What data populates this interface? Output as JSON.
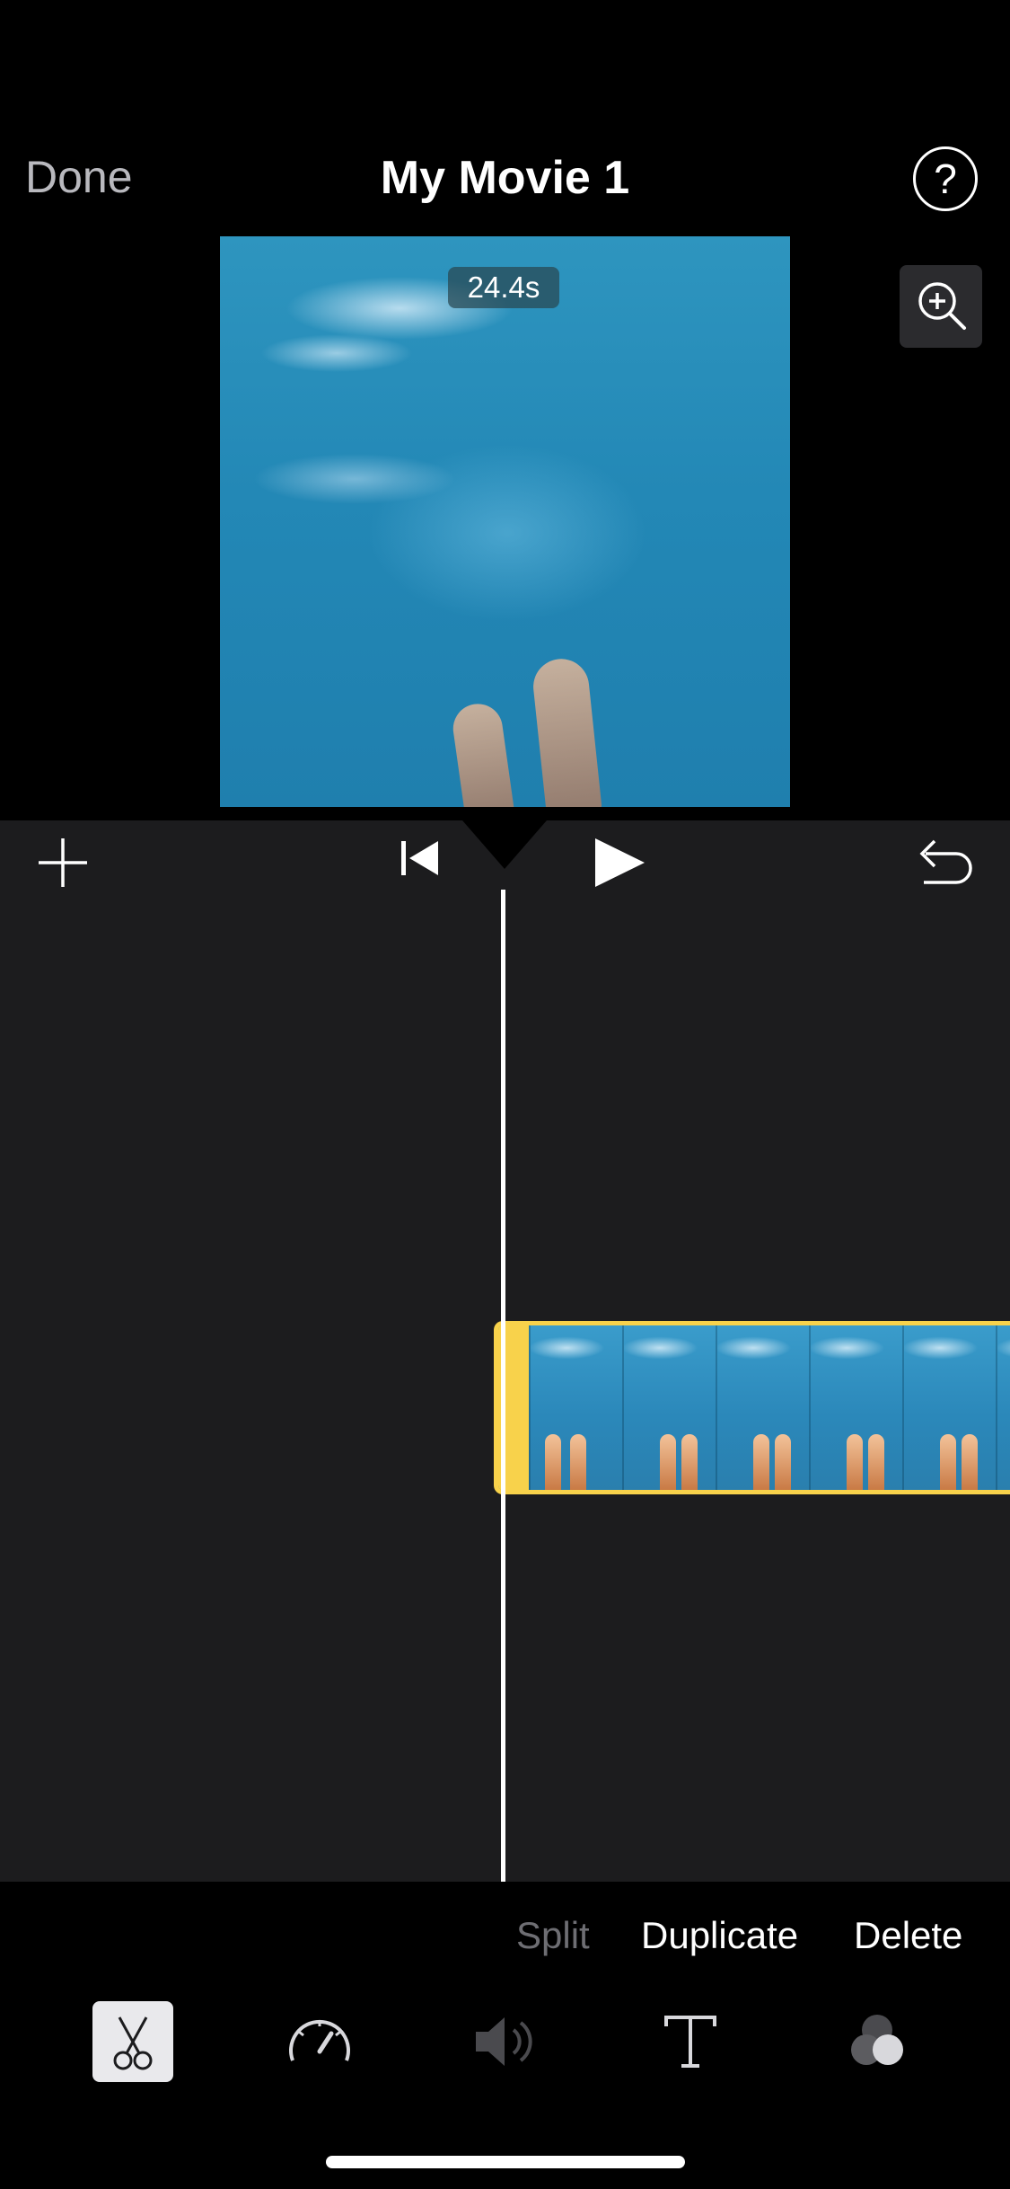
{
  "header": {
    "done_label": "Done",
    "title": "My Movie 1",
    "help_label": "?"
  },
  "preview": {
    "duration_label": "24.4s"
  },
  "toolbar": {
    "icons": [
      "plus-icon",
      "skip-to-start-icon",
      "play-icon",
      "undo-icon"
    ]
  },
  "timeline": {
    "clip_selected": true,
    "clip_color": "#f8d24b"
  },
  "actions": {
    "split_label": "Split",
    "split_enabled": false,
    "duplicate_label": "Duplicate",
    "delete_label": "Delete"
  },
  "tools": {
    "icons": [
      "scissors-icon",
      "speed-icon",
      "volume-icon",
      "text-icon",
      "filters-icon"
    ],
    "selected": "scissors-icon"
  },
  "colors": {
    "accent": "#f8d24b",
    "background": "#000000",
    "timeline_bg": "#1c1c1e",
    "disabled_text": "#6e6e73"
  }
}
